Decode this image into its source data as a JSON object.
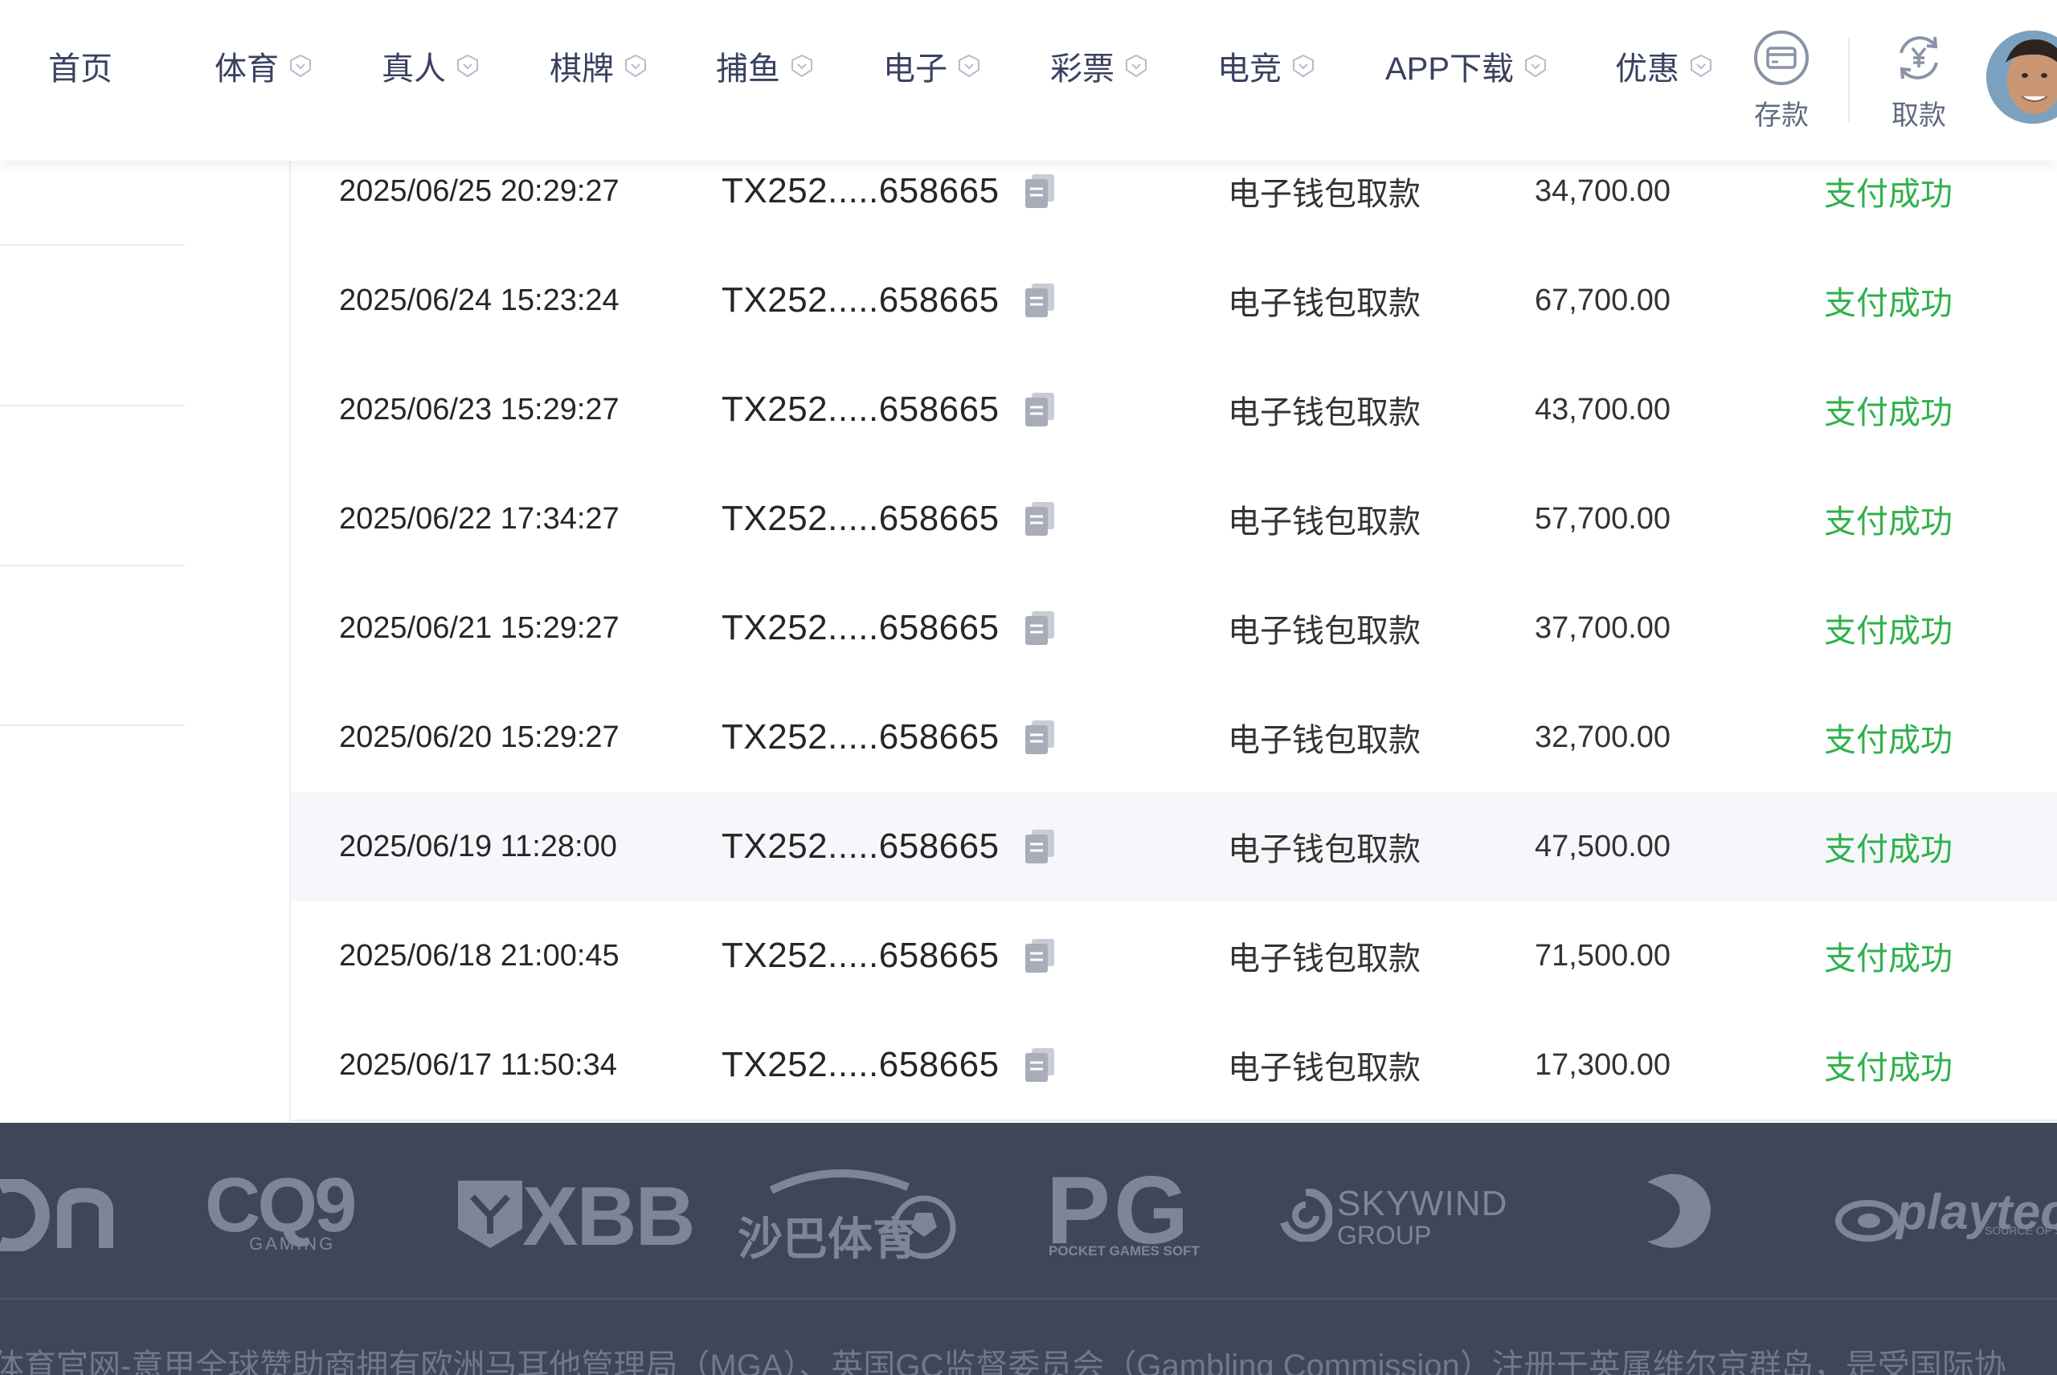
{
  "nav": {
    "items": [
      {
        "label": "首页",
        "has_chevron": false
      },
      {
        "label": "体育",
        "has_chevron": true
      },
      {
        "label": "真人",
        "has_chevron": true
      },
      {
        "label": "棋牌",
        "has_chevron": true
      },
      {
        "label": "捕鱼",
        "has_chevron": true
      },
      {
        "label": "电子",
        "has_chevron": true
      },
      {
        "label": "彩票",
        "has_chevron": true
      },
      {
        "label": "电竞",
        "has_chevron": true
      },
      {
        "label": "APP下载",
        "has_chevron": true
      },
      {
        "label": "优惠",
        "has_chevron": true
      }
    ],
    "deposit_label": "存款",
    "withdraw_label": "取款"
  },
  "records": [
    {
      "time": "2025/06/25 20:29:27",
      "order_id": "TX252.....658665",
      "type": "电子钱包取款",
      "amount": "34,700.00",
      "status": "支付成功"
    },
    {
      "time": "2025/06/24 15:23:24",
      "order_id": "TX252.....658665",
      "type": "电子钱包取款",
      "amount": "67,700.00",
      "status": "支付成功"
    },
    {
      "time": "2025/06/23 15:29:27",
      "order_id": "TX252.....658665",
      "type": "电子钱包取款",
      "amount": "43,700.00",
      "status": "支付成功"
    },
    {
      "time": "2025/06/22 17:34:27",
      "order_id": "TX252.....658665",
      "type": "电子钱包取款",
      "amount": "57,700.00",
      "status": "支付成功"
    },
    {
      "time": "2025/06/21 15:29:27",
      "order_id": "TX252.....658665",
      "type": "电子钱包取款",
      "amount": "37,700.00",
      "status": "支付成功"
    },
    {
      "time": "2025/06/20 15:29:27",
      "order_id": "TX252.....658665",
      "type": "电子钱包取款",
      "amount": "32,700.00",
      "status": "支付成功"
    },
    {
      "time": "2025/06/19 11:28:00",
      "order_id": "TX252.....658665",
      "type": "电子钱包取款",
      "amount": "47,500.00",
      "status": "支付成功"
    },
    {
      "time": "2025/06/18 21:00:45",
      "order_id": "TX252.....658665",
      "type": "电子钱包取款",
      "amount": "71,500.00",
      "status": "支付成功"
    },
    {
      "time": "2025/06/17 11:50:34",
      "order_id": "TX252.....658665",
      "type": "电子钱包取款",
      "amount": "17,300.00",
      "status": "支付成功"
    }
  ],
  "providers": {
    "cq9": "CQ9",
    "cq9_sub": "GAMING",
    "xbb": "XBB",
    "saba": "沙巴体育",
    "pg": "PG",
    "pg_sub": "POCKET GAMES SOFT",
    "skywind": "SKYWIND",
    "skywind_sub": "GROUP",
    "playtech": "playtech",
    "playtech_sub": "SOURCE OF SUCCESS"
  },
  "footer": {
    "text": "体育官网-意甲全球赞助商拥有欧洲马耳他管理局（MGA）、英国GC监督委员会（Gambling Commission）注册于英属维尔京群岛，是受国际协"
  },
  "colors": {
    "status_success": "#2fb14b",
    "nav_text": "#3a4060",
    "footer_bg": "#3f4657"
  }
}
